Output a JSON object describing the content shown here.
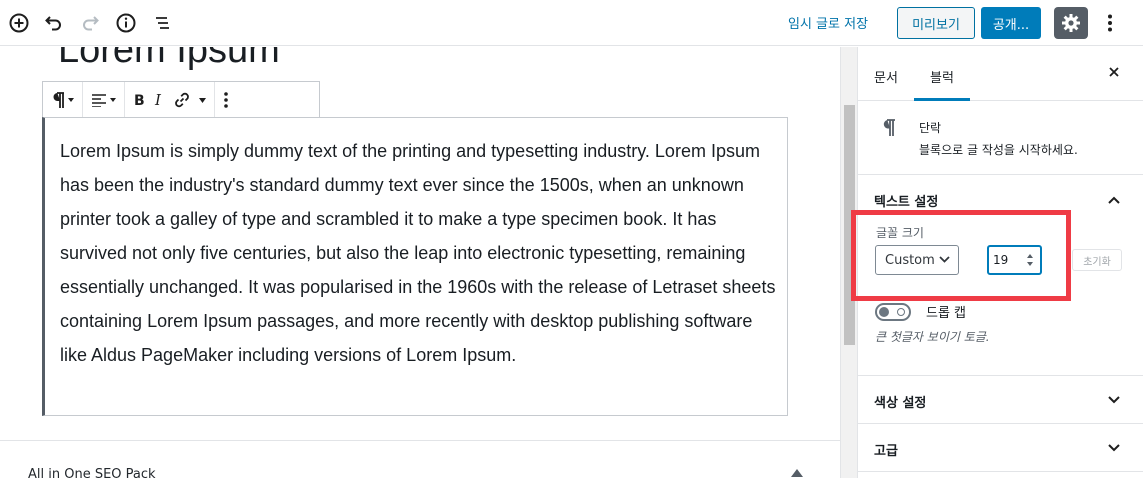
{
  "topbar": {
    "save_draft": "임시 글로 저장",
    "preview": "미리보기",
    "publish": "공개..."
  },
  "editor": {
    "post_title": "Lorem Ipsum",
    "paragraph": "Lorem Ipsum is simply dummy text of the printing and typesetting industry. Lorem Ipsum has been the industry's standard dummy text ever since the 1500s, when an unknown printer took a galley of type and scrambled it to make a type specimen book. It has survived not only five centuries, but also the leap into electronic typesetting, remaining essentially unchanged. It was popularised in the 1960s with the release of Letraset sheets containing Lorem Ipsum passages, and more recently with desktop publishing software like Aldus PageMaker including versions of Lorem Ipsum.",
    "seo_panel_title": "All in One SEO Pack"
  },
  "sidebar": {
    "tabs": [
      {
        "label": "문서"
      },
      {
        "label": "블럭"
      }
    ],
    "block_card": {
      "title": "단락",
      "description": "블록으로 글 작성을 시작하세요."
    },
    "text_settings": {
      "title": "텍스트 설정",
      "font_size_label": "글꼴 크기",
      "font_size_selected": "Custom",
      "font_size_value": "19",
      "reset_label": "초기화",
      "drop_cap_label": "드롭 캡",
      "drop_cap_help": "큰 첫글자 보이기 토글."
    },
    "color_settings_title": "색상 설정",
    "advanced_title": "고급"
  },
  "colors": {
    "accent": "#007cba",
    "highlight": "#ef3b45",
    "settings_bg": "#555d66"
  }
}
